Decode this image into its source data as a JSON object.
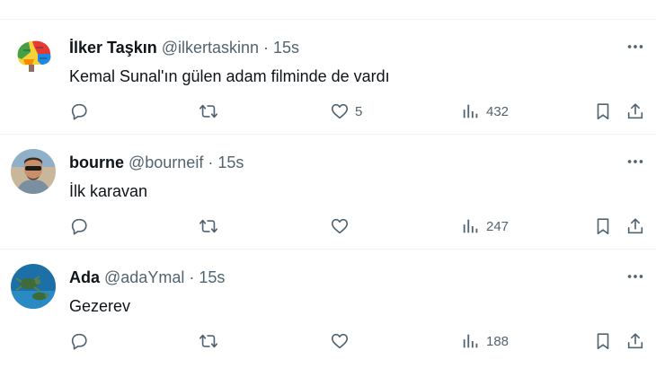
{
  "tweets": [
    {
      "display_name": "İlker Taşkın",
      "handle": "@ilkertaskinn",
      "separator": "·",
      "time": "15s",
      "text": "Kemal Sunal'ın gülen adam filminde de vardı",
      "likes": "5",
      "views": "432",
      "avatar": "brain-diagram"
    },
    {
      "display_name": "bourne",
      "handle": "@bourneif",
      "separator": "·",
      "time": "15s",
      "text": "İlk karavan",
      "likes": "",
      "views": "247",
      "avatar": "man-with-sunglasses"
    },
    {
      "display_name": "Ada",
      "handle": "@adaYmal",
      "separator": "·",
      "time": "15s",
      "text": "Gezerev",
      "likes": "",
      "views": "188",
      "avatar": "sea-turtles"
    }
  ],
  "icons": {
    "more": "more-horizontal-icon",
    "reply": "reply-icon",
    "retweet": "retweet-icon",
    "like": "heart-icon",
    "views": "views-chart-icon",
    "bookmark": "bookmark-icon",
    "share": "share-icon"
  },
  "colors": {
    "text": "#0f1419",
    "secondary": "#536471",
    "divider": "#eff3f4"
  }
}
